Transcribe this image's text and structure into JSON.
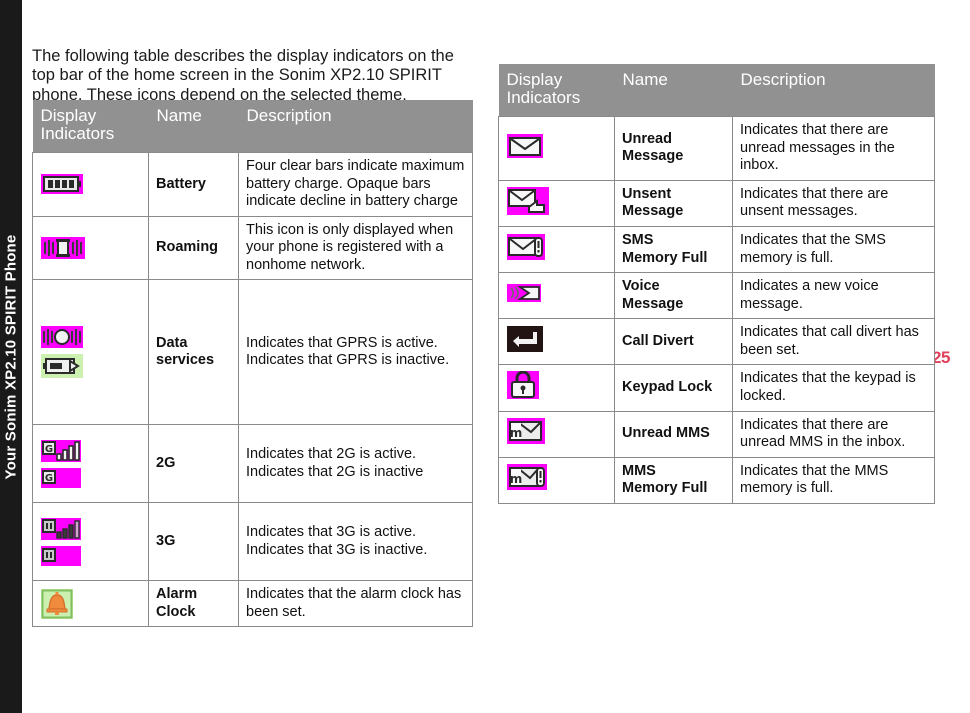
{
  "sidebar": {
    "label": "Your Sonim XP2.10 SPIRIT Phone"
  },
  "page": {
    "number": "25",
    "accent_color": "#e0405a"
  },
  "intro": {
    "text": "The following table describes the display indicators on the top bar of the home screen in the Sonim XP2.10 SPIRIT phone. These icons depend on the selected theme."
  },
  "table_header": {
    "col1": "Display Indicators",
    "col1_line1": "Display",
    "col1_line2": "Indicators",
    "col2": "Name",
    "col3": "Description",
    "bg_color": "#919191",
    "text_color": "#ffffff"
  },
  "left_table": {
    "rows": [
      {
        "name": "Battery",
        "icons": [
          "battery-icon"
        ],
        "desc_lines": [
          "Four clear bars indicate maximum battery charge. Opaque bars indicate decline in battery charge"
        ]
      },
      {
        "name": "Roaming",
        "icons": [
          "roaming-icon"
        ],
        "desc_lines": [
          "This icon is only displayed when your phone is registered with a nonhome network."
        ]
      },
      {
        "name": "Data services",
        "name_line1": "Data",
        "name_line2": "services",
        "icons": [
          "gprs-active-icon",
          "gprs-inactive-icon"
        ],
        "desc_lines": [
          "Indicates that GPRS is active.",
          "Indicates that GPRS is inactive."
        ]
      },
      {
        "name": "2G",
        "icons": [
          "2g-active-icon",
          "2g-inactive-icon"
        ],
        "desc_lines": [
          "Indicates that 2G is active.",
          "Indicates that 2G is inactive"
        ]
      },
      {
        "name": "3G",
        "icons": [
          "3g-active-icon",
          "3g-inactive-icon"
        ],
        "desc_lines": [
          "Indicates that 3G is active.",
          "Indicates that 3G is inactive."
        ]
      },
      {
        "name": "Alarm Clock",
        "name_line1": "Alarm",
        "name_line2": "Clock",
        "icons": [
          "alarm-clock-icon"
        ],
        "desc_lines": [
          "Indicates that the alarm clock has been set."
        ]
      }
    ]
  },
  "right_table": {
    "rows": [
      {
        "name": "Unread Message",
        "name_line1": "Unread",
        "name_line2": "Message",
        "icons": [
          "unread-message-icon"
        ],
        "desc_lines": [
          "Indicates that there are unread messages in the inbox."
        ]
      },
      {
        "name": "Unsent Message",
        "name_line1": "Unsent",
        "name_line2": "Message",
        "icons": [
          "unsent-message-icon"
        ],
        "desc_lines": [
          "Indicates that there are unsent messages."
        ]
      },
      {
        "name": "SMS Memory Full",
        "name_line1": "SMS",
        "name_line2": "Memory Full",
        "icons": [
          "sms-memory-full-icon"
        ],
        "desc_lines": [
          "Indicates that the SMS memory is full."
        ]
      },
      {
        "name": "Voice Message",
        "name_line1": "Voice",
        "name_line2": "Message",
        "icons": [
          "voice-message-icon"
        ],
        "desc_lines": [
          "Indicates a new voice message."
        ]
      },
      {
        "name": "Call Divert",
        "name_line1": "Call Divert",
        "name_line2": "",
        "icons": [
          "call-divert-icon"
        ],
        "desc_lines": [
          "Indicates that call divert has been set."
        ]
      },
      {
        "name": "Keypad Lock",
        "name_line1": "Keypad Lock",
        "name_line2": "",
        "icons": [
          "keypad-lock-icon"
        ],
        "desc_lines": [
          "Indicates that the keypad is locked."
        ]
      },
      {
        "name": "Unread MMS",
        "name_line1": "Unread MMS",
        "name_line2": "",
        "icons": [
          "unread-mms-icon"
        ],
        "desc_lines": [
          "Indicates that there are unread MMS in the inbox."
        ]
      },
      {
        "name": "MMS Memory Full",
        "name_line1": "MMS",
        "name_line2": "Memory Full",
        "icons": [
          "mms-memory-full-icon"
        ],
        "desc_lines": [
          "Indicates that the MMS memory is full."
        ]
      }
    ]
  },
  "icon_colors": {
    "theme_background": "#ff00ff",
    "inactive_background": "#ccf0b0",
    "call_divert_background": "#231414",
    "alarm_bell": "#f08a3c",
    "glyph_outline": "#2a2a2a"
  }
}
